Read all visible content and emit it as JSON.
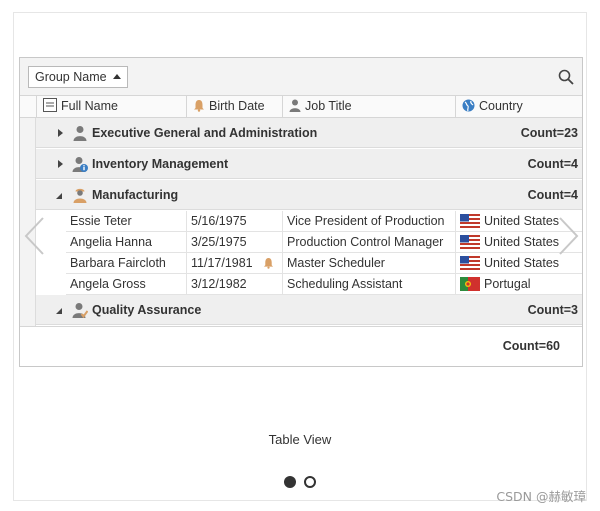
{
  "toolbar": {
    "group_button_label": "Group Name",
    "search_icon": "search-icon"
  },
  "columns": [
    {
      "label": "Full Name",
      "icon": "text-field-icon"
    },
    {
      "label": "Birth Date",
      "icon": "bell-icon"
    },
    {
      "label": "Job Title",
      "icon": "person-icon"
    },
    {
      "label": "Country",
      "icon": "globe-icon"
    }
  ],
  "groups": [
    {
      "name": "Executive General and Administration",
      "count": "Count=23",
      "expanded": false,
      "icon": "person-icon"
    },
    {
      "name": "Inventory Management",
      "count": "Count=4",
      "expanded": false,
      "icon": "person-info-icon"
    },
    {
      "name": "Manufacturing",
      "count": "Count=4",
      "expanded": true,
      "icon": "worker-icon"
    },
    {
      "name": "Quality Assurance",
      "count": "Count=3",
      "expanded": true,
      "icon": "person-check-icon"
    }
  ],
  "rows": [
    {
      "name": "Essie Teter",
      "birth": "5/16/1975",
      "bell": false,
      "job": "Vice President of Production",
      "country": "United States",
      "flag": "us-flag-icon"
    },
    {
      "name": "Angelia Hanna",
      "birth": "3/25/1975",
      "bell": false,
      "job": "Production Control Manager",
      "country": "United States",
      "flag": "us-flag-icon"
    },
    {
      "name": "Barbara Faircloth",
      "birth": "11/17/1981",
      "bell": true,
      "job": "Master Scheduler",
      "country": "United States",
      "flag": "us-flag-icon"
    },
    {
      "name": "Angela Gross",
      "birth": "3/12/1982",
      "bell": false,
      "job": "Scheduling Assistant",
      "country": "Portugal",
      "flag": "portugal-flag-icon"
    }
  ],
  "footer": {
    "total": "Count=60"
  },
  "caption": "Table View",
  "pager": {
    "pages": 2,
    "active": 1
  },
  "watermark": "CSDN @赫敏璋",
  "colors": {
    "bell": "#d9a066",
    "person": "#7a7a7a",
    "globe": "#3a7ec4"
  }
}
